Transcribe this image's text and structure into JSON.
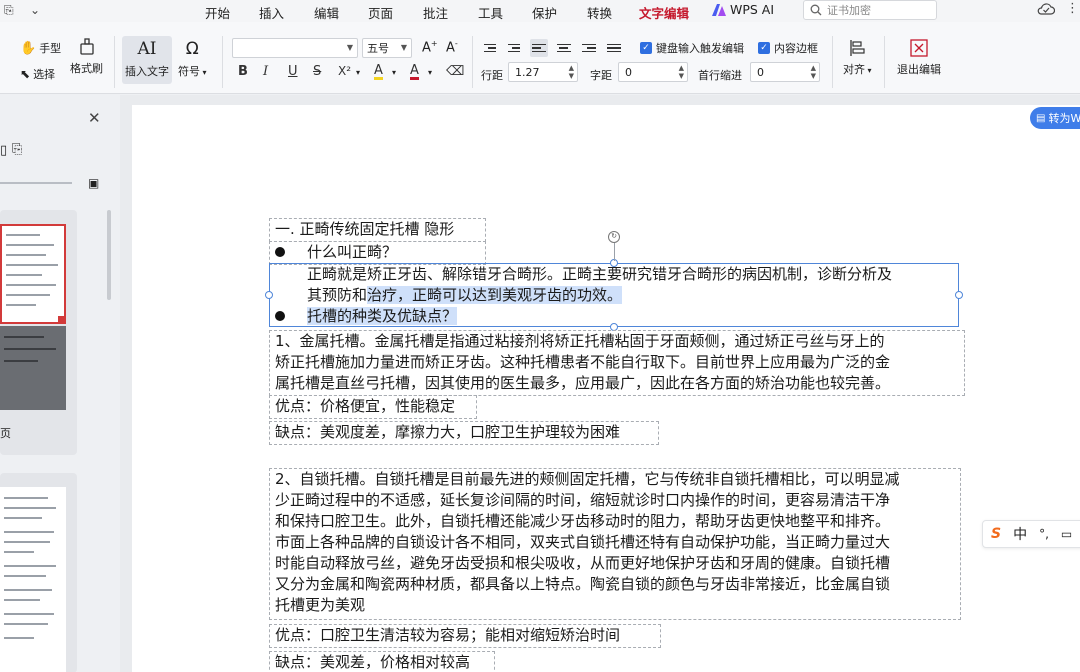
{
  "menubar": {
    "left_icon_a": "⎘",
    "left_icon_b": "⌄",
    "tabs": [
      "开始",
      "插入",
      "编辑",
      "页面",
      "批注",
      "工具",
      "保护",
      "转换",
      "文字编辑"
    ],
    "wps_ai": "WPS AI",
    "search_placeholder": "证书加密"
  },
  "ribbon": {
    "hand_tool": "手型",
    "select_tool": "选择",
    "format_painter": "格式刷",
    "insert_text": "插入文字",
    "symbol": "符号",
    "font_name": "",
    "font_size": "五号",
    "bold": "B",
    "italic": "I",
    "underline": "U",
    "strikethrough": "S",
    "superscript": "X²",
    "highlight": "A",
    "font_color": "A",
    "clear_format": "⌫",
    "line_spacing_label": "行距",
    "line_spacing_value": "1.27",
    "char_spacing_label": "字距",
    "char_spacing_value": "0",
    "first_indent_label": "首行缩进",
    "first_indent_value": "0",
    "keyboard_trigger_label": "键盘输入触发编辑",
    "content_border_label": "内容边框",
    "align_label": "对齐",
    "exit_edit_label": "退出编辑"
  },
  "leftpanel": {
    "page_caption": "页"
  },
  "document": {
    "heading": "一. 正畸传统固定托槽 隐形",
    "bullet1": "什么叫正畸？",
    "para1_line1": "正畸就是矫正牙齿、解除错牙合畸形。正畸主要研究错牙合畸形的病因机制，诊断分析及",
    "para1_line2_plain": "其预防和",
    "para1_line2_highlight": "治疗，正畸可以达到美观牙齿的功效。",
    "bullet2": "托槽的种类及优缺点？",
    "metal_line1": "1、金属托槽。金属托槽是指通过粘接剂将矫正托槽粘固于牙面颊侧，通过矫正弓丝与牙上的",
    "metal_line2": "矫正托槽施加力量进而矫正牙齿。这种托槽患者不能自行取下。目前世界上应用最为广泛的金",
    "metal_line3": "属托槽是直丝弓托槽，因其使用的医生最多，应用最广，因此在各方面的矫治功能也较完善。",
    "metal_pros": "优点：价格便宜，性能稳定",
    "metal_cons": "缺点：美观度差，摩擦力大，口腔卫生护理较为困难",
    "self_line1": "2、自锁托槽。自锁托槽是目前最先进的颊侧固定托槽，它与传统非自锁托槽相比，可以明显减",
    "self_line2": "少正畸过程中的不适感，延长复诊间隔的时间，缩短就诊时口内操作的时间，更容易清洁干净",
    "self_line3": "和保持口腔卫生。此外，自锁托槽还能减少牙齿移动时的阻力，帮助牙齿更快地整平和排齐。",
    "self_line4": "市面上各种品牌的自锁设计各不相同，双夹式自锁托槽还特有自动保护功能，当正畸力量过大",
    "self_line5": "时能自动释放弓丝，避免牙齿受损和根尖吸收，从而更好地保护牙齿和牙周的健康。自锁托槽",
    "self_line6": "又分为金属和陶瓷两种材质，都具备以上特点。陶瓷自锁的颜色与牙齿非常接近，比金属自锁",
    "self_line7": "托槽更为美观",
    "self_pros": "优点：口腔卫生清洁较为容易；能相对缩短矫治时间",
    "self_cons": "缺点：美观差，价格相对较高"
  },
  "overlays": {
    "convert_button": "转为W",
    "ime_logo": "S",
    "ime_mode": "中",
    "ime_punct": "°,"
  },
  "colors": {
    "accent_red": "#c5192d",
    "selection_blue": "#4f86d9",
    "highlight_blue": "#cfe0fa",
    "checkbox_blue": "#2f6fe0"
  }
}
